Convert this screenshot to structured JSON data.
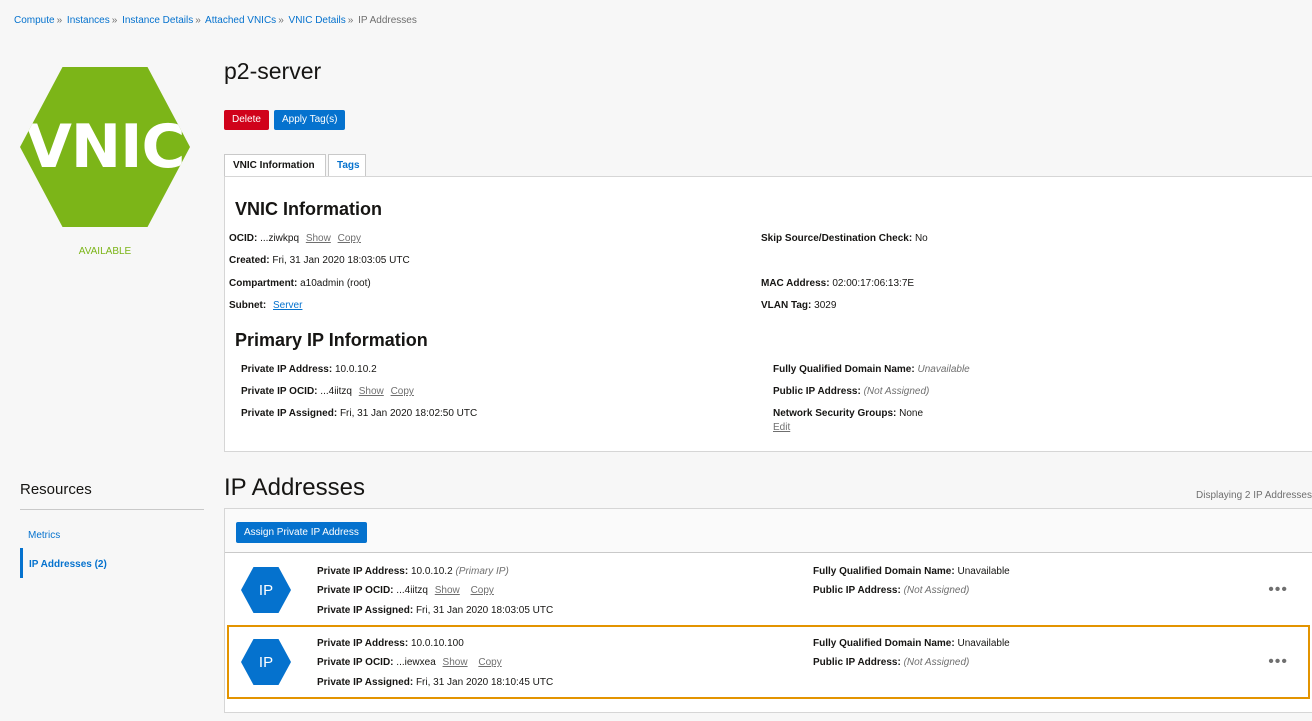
{
  "breadcrumb": {
    "items": [
      "Compute",
      "Instances",
      "Instance Details",
      "Attached VNICs",
      "VNIC Details"
    ],
    "separator": "»",
    "current": "IP Addresses"
  },
  "resource": {
    "icon_text": "VNIC",
    "status": "AVAILABLE",
    "title": "p2-server",
    "color": "#7cb518"
  },
  "actions": {
    "delete_label": "Delete",
    "apply_tags_label": "Apply Tag(s)"
  },
  "tabs": [
    {
      "label": "VNIC Information",
      "active": true
    },
    {
      "label": "Tags",
      "active": false
    }
  ],
  "vnic_info": {
    "heading": "VNIC Information",
    "ocid_label": "OCID:",
    "ocid_value": "...ziwkpq",
    "show_label": "Show",
    "copy_label": "Copy",
    "created_label": "Created:",
    "created_value": "Fri, 31 Jan 2020 18:03:05 UTC",
    "compartment_label": "Compartment:",
    "compartment_value": "a10admin (root)",
    "subnet_label": "Subnet:",
    "subnet_value": "Server",
    "skip_label": "Skip Source/Destination Check:",
    "skip_value": "No",
    "mac_label": "MAC Address:",
    "mac_value": "02:00:17:06:13:7E",
    "vlan_label": "VLAN Tag:",
    "vlan_value": "3029"
  },
  "primary_ip": {
    "heading": "Primary IP Information",
    "private_ip_label": "Private IP Address:",
    "private_ip_value": "10.0.10.2",
    "ocid_label": "Private IP OCID:",
    "ocid_value": "...4iitzq",
    "show_label": "Show",
    "copy_label": "Copy",
    "assigned_label": "Private IP Assigned:",
    "assigned_value": "Fri, 31 Jan 2020 18:02:50 UTC",
    "fqdn_label": "Fully Qualified Domain Name:",
    "fqdn_value": "Unavailable",
    "public_label": "Public IP Address:",
    "public_value": "(Not Assigned)",
    "nsg_label": "Network Security Groups:",
    "nsg_value": "None",
    "edit_label": "Edit"
  },
  "resources_nav": {
    "title": "Resources",
    "items": [
      {
        "label": "Metrics",
        "active": false
      },
      {
        "label": "IP Addresses (2)",
        "active": true
      }
    ]
  },
  "ip_addresses": {
    "heading": "IP Addresses",
    "displaying": "Displaying 2 IP Addresses",
    "assign_label": "Assign Private IP Address",
    "rows": [
      {
        "icon_text": "IP",
        "private_ip_label": "Private IP Address:",
        "private_ip_value": "10.0.10.2",
        "primary_tag": "(Primary IP)",
        "ocid_label": "Private IP OCID:",
        "ocid_value": "...4iitzq",
        "show_label": "Show",
        "copy_label": "Copy",
        "assigned_label": "Private IP Assigned:",
        "assigned_value": "Fri, 31 Jan 2020 18:03:05 UTC",
        "fqdn_label": "Fully Qualified Domain Name:",
        "fqdn_value": "Unavailable",
        "public_label": "Public IP Address:",
        "public_value": "(Not Assigned)",
        "menu": "•••"
      },
      {
        "icon_text": "IP",
        "private_ip_label": "Private IP Address:",
        "private_ip_value": "10.0.10.100",
        "primary_tag": "",
        "ocid_label": "Private IP OCID:",
        "ocid_value": "...iewxea",
        "show_label": "Show",
        "copy_label": "Copy",
        "assigned_label": "Private IP Assigned:",
        "assigned_value": "Fri, 31 Jan 2020 18:10:45 UTC",
        "fqdn_label": "Fully Qualified Domain Name:",
        "fqdn_value": "Unavailable",
        "public_label": "Public IP Address:",
        "public_value": "(Not Assigned)",
        "menu": "•••"
      }
    ]
  },
  "colors": {
    "accent": "#0572ce",
    "danger": "#d0021b",
    "highlight": "#e39400"
  }
}
